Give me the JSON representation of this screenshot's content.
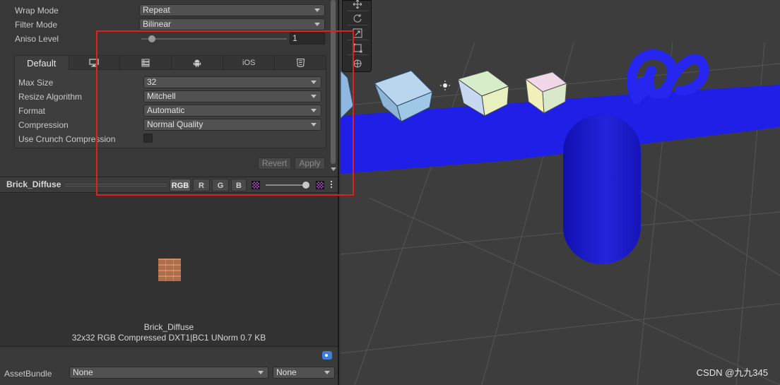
{
  "inspector": {
    "wrap_mode": {
      "label": "Wrap Mode",
      "value": "Repeat"
    },
    "filter_mode": {
      "label": "Filter Mode",
      "value": "Bilinear"
    },
    "aniso_level": {
      "label": "Aniso Level",
      "value": "1"
    },
    "platform_tabs": [
      {
        "label": "Default",
        "icon": "default-tab"
      },
      {
        "label": "",
        "icon": "monitor-icon"
      },
      {
        "label": "",
        "icon": "server-icon"
      },
      {
        "label": "",
        "icon": "android-icon"
      },
      {
        "label": "iOS",
        "icon": "ios-tab"
      },
      {
        "label": "",
        "icon": "html5-icon"
      }
    ],
    "max_size": {
      "label": "Max Size",
      "value": "32"
    },
    "resize_algorithm": {
      "label": "Resize Algorithm",
      "value": "Mitchell"
    },
    "format": {
      "label": "Format",
      "value": "Automatic"
    },
    "compression": {
      "label": "Compression",
      "value": "Normal Quality"
    },
    "crunch": {
      "label": "Use Crunch Compression",
      "checked": false
    },
    "revert_label": "Revert",
    "apply_label": "Apply"
  },
  "preview": {
    "title": "Brick_Diffuse",
    "channels": [
      "RGB",
      "R",
      "G",
      "B"
    ],
    "texture_name": "Brick_Diffuse",
    "texture_info": "32x32  RGB Compressed DXT1|BC1 UNorm   0.7 KB"
  },
  "asset_bundle": {
    "label": "AssetBundle",
    "name_value": "None",
    "variant_value": "None"
  },
  "scene": {
    "watermark": "CSDN @九九345"
  },
  "colors": {
    "highlight": "#e0201e",
    "plane_blue": "#1f1fe8",
    "tag_blue": "#3b7fd6"
  }
}
